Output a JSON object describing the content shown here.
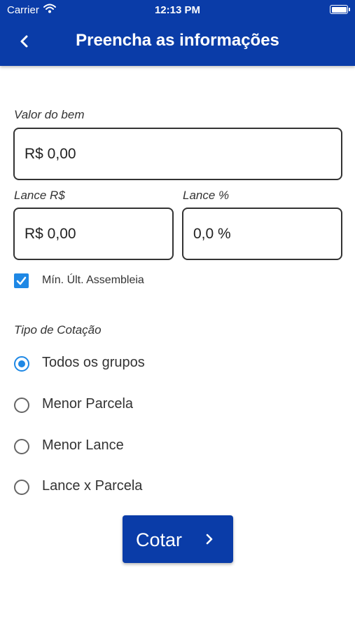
{
  "status_bar": {
    "carrier": "Carrier",
    "time": "12:13 PM"
  },
  "header": {
    "title": "Preencha as informações",
    "back_icon": "chevron-left-icon"
  },
  "form": {
    "valor_do_bem": {
      "label": "Valor do bem",
      "value": "R$ 0,00"
    },
    "lance_rs": {
      "label": "Lance R$",
      "value": "R$ 0,00"
    },
    "lance_pct": {
      "label": "Lance %",
      "value": "0,0 %"
    },
    "min_ult_assembleia": {
      "label": "Mín. Últ. Assembleia",
      "checked": true
    }
  },
  "tipo_cotacao": {
    "label": "Tipo de Cotação",
    "options": [
      {
        "label": "Todos os grupos",
        "selected": true
      },
      {
        "label": "Menor Parcela",
        "selected": false
      },
      {
        "label": "Menor Lance",
        "selected": false
      },
      {
        "label": "Lance x Parcela",
        "selected": false
      }
    ]
  },
  "actions": {
    "cotar_label": "Cotar"
  },
  "colors": {
    "primary": "#0a3ca8",
    "accent": "#1e88e5"
  }
}
